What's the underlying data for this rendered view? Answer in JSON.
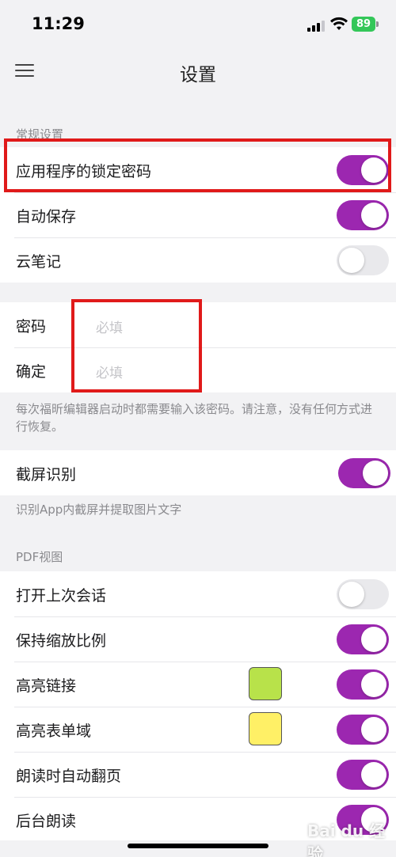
{
  "status": {
    "time": "11:29",
    "battery": "89"
  },
  "nav": {
    "title": "设置"
  },
  "general": {
    "label": "常规设置",
    "lock_password": "应用程序的锁定密码",
    "auto_save": "自动保存",
    "cloud_notes": "云笔记"
  },
  "password": {
    "password_label": "密码",
    "password_placeholder": "必填",
    "confirm_label": "确定",
    "confirm_placeholder": "必填",
    "note": "每次福昕编辑器启动时都需要输入该密码。请注意，没有任何方式进行恢复。"
  },
  "screenshot": {
    "label": "截屏识别",
    "note": "识别App内截屏并提取图片文字"
  },
  "pdf": {
    "label": "PDF视图",
    "open_last": "打开上次会话",
    "keep_zoom": "保持缩放比例",
    "highlight_links": "高亮链接",
    "highlight_forms": "高亮表单域",
    "auto_turn": "朗读时自动翻页",
    "bg_read": "后台朗读"
  },
  "colors": {
    "accent": "#9c27b0",
    "link_highlight": "#b8e24a",
    "form_highlight": "#fff066"
  },
  "watermark": "Bai du 经验"
}
